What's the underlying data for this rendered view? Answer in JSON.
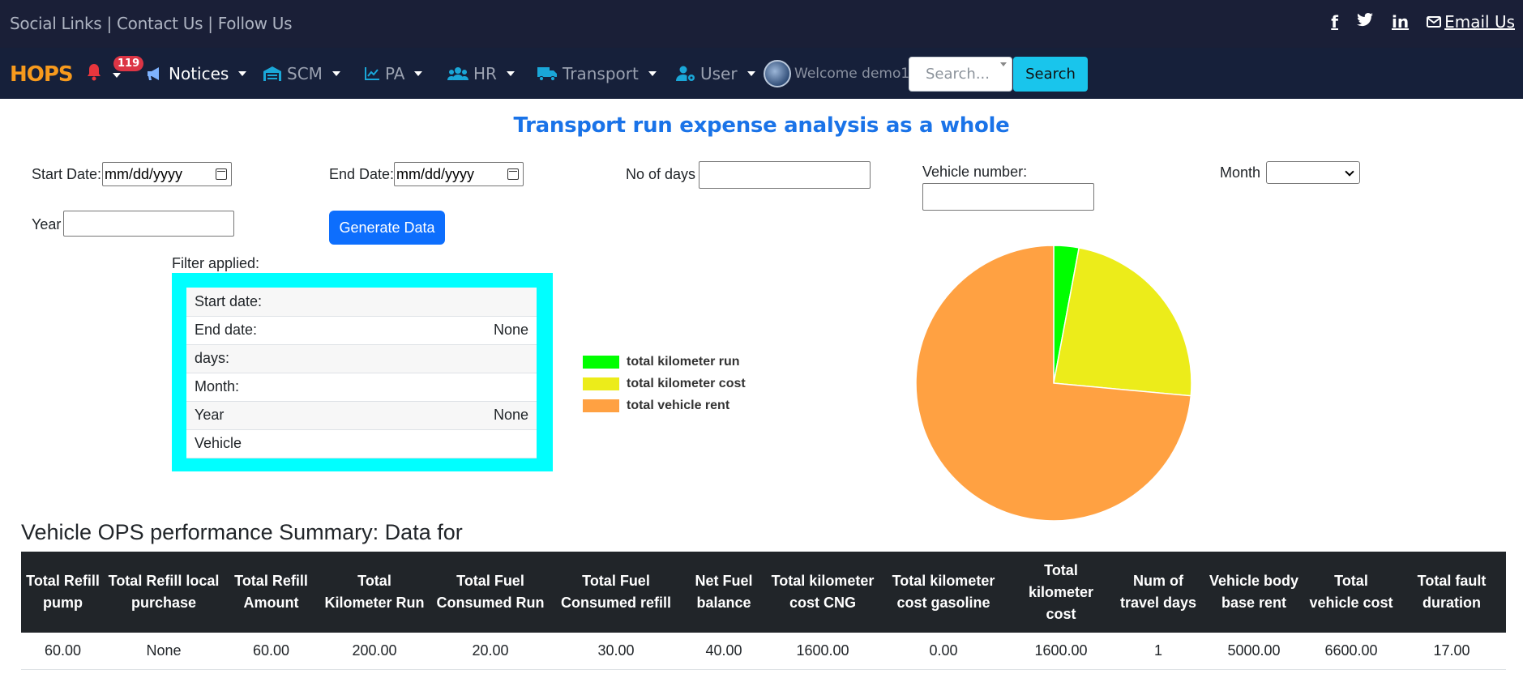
{
  "topbar": {
    "links_text": "Social Links | Contact Us | Follow Us",
    "facebook_label": "f",
    "twitter_icon": "twitter-icon",
    "linkedin_label": "in",
    "email_label": "Email Us"
  },
  "navbar": {
    "brand": "HOPS",
    "notification_count": "119",
    "notices": "Notices",
    "scm": "SCM",
    "pa": "PA",
    "hr": "HR",
    "transport": "Transport",
    "user": "User",
    "welcome": "Welcome demo1",
    "search_placeholder": "Search...",
    "search_button": "Search"
  },
  "page": {
    "title": "Transport run expense analysis as a whole"
  },
  "form": {
    "start_date_label": "Start Date:",
    "start_date_value": "mm/dd/yyyy",
    "end_date_label": "End Date:",
    "end_date_value": "mm/dd/yyyy",
    "no_of_days_label": "No of days",
    "vehicle_number_label": "Vehicle number:",
    "month_label": "Month",
    "year_label": "Year",
    "generate_button": "Generate Data"
  },
  "filter": {
    "heading": "Filter applied:",
    "rows": [
      {
        "label": "Start date:",
        "value": ""
      },
      {
        "label": "End date:",
        "value": "None"
      },
      {
        "label": "days:",
        "value": ""
      },
      {
        "label": "Month:",
        "value": ""
      },
      {
        "label": "Year",
        "value": "None"
      },
      {
        "label": "Vehicle",
        "value": ""
      }
    ]
  },
  "chart_data": {
    "type": "pie",
    "labels": [
      "total kilometer run",
      "total kilometer cost",
      "total vehicle rent"
    ],
    "values": [
      200,
      1600,
      5000
    ],
    "colors": [
      "#00ff00",
      "#ecec1a",
      "#ffa142"
    ],
    "legend_position": "left"
  },
  "summary": {
    "title": "Vehicle OPS performance Summary: Data for",
    "headers": [
      "Total Refill pump",
      "Total Refill local purchase",
      "Total Refill Amount",
      "Total Kilometer Run",
      "Total Fuel Consumed Run",
      "Total Fuel Consumed refill",
      "Net Fuel balance",
      "Total kilometer cost CNG",
      "Total kilometer cost gasoline",
      "Total kilometer cost",
      "Num of travel days",
      "Vehicle body base rent",
      "Total vehicle cost",
      "Total fault duration"
    ],
    "row": [
      "60.00",
      "None",
      "60.00",
      "200.00",
      "20.00",
      "30.00",
      "40.00",
      "1600.00",
      "0.00",
      "1600.00",
      "1",
      "5000.00",
      "6600.00",
      "17.00"
    ]
  }
}
